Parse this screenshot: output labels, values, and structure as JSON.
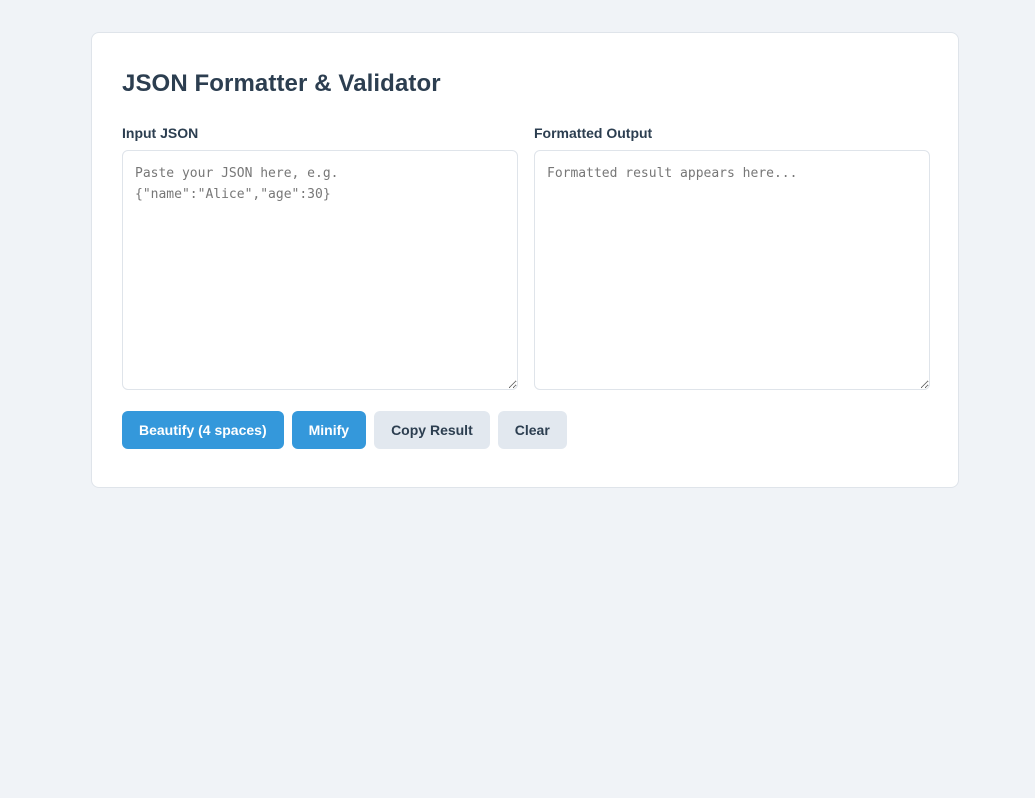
{
  "page": {
    "title": "JSON Formatter & Validator"
  },
  "input": {
    "label": "Input JSON",
    "placeholder": "Paste your JSON here, e.g.\n{\"name\":\"Alice\",\"age\":30}",
    "value": ""
  },
  "output": {
    "label": "Formatted Output",
    "placeholder": "Formatted result appears here...",
    "value": ""
  },
  "buttons": {
    "beautify": "Beautify (4 spaces)",
    "minify": "Minify",
    "copy": "Copy Result",
    "clear": "Clear"
  },
  "colors": {
    "background": "#f0f3f7",
    "card": "#ffffff",
    "primary": "#3498db",
    "secondary": "#e2e8ef",
    "text": "#2c3e50"
  }
}
